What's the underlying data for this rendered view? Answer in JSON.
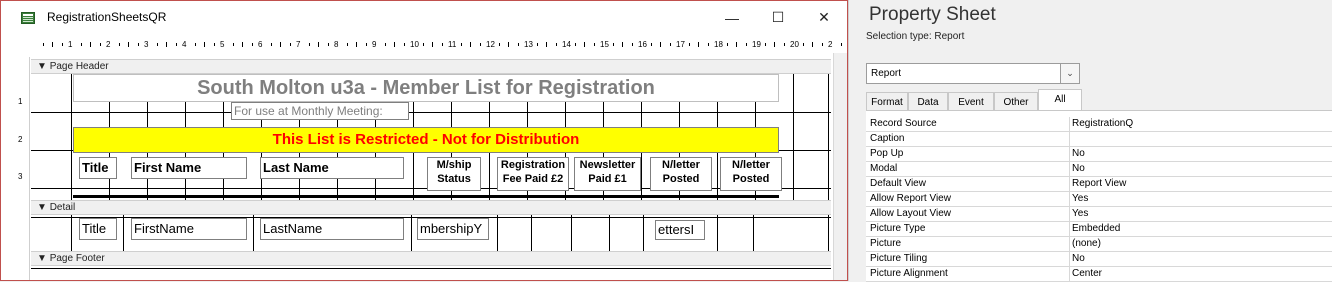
{
  "report_window": {
    "title": "RegistrationSheetsQR",
    "controls": {
      "minimize": "—",
      "maximize": "☐",
      "close": "✕"
    },
    "ruler_numbers": [
      "1",
      "2",
      "3",
      "4",
      "5",
      "6",
      "7",
      "8",
      "9",
      "10",
      "11",
      "12",
      "13",
      "14",
      "15",
      "16",
      "17",
      "18",
      "19",
      "20",
      "2"
    ],
    "left_ruler_numbers": [
      "1",
      "2",
      "3"
    ],
    "sections": {
      "page_header": "Page Header",
      "detail": "Detail",
      "page_footer": "Page Footer"
    },
    "header": {
      "title": "South Molton u3a - Member List for Registration",
      "subtitle": "For use at Monthly Meeting:",
      "banner": "This List is Restricted - Not for Distribution",
      "banner_color": "#ffff00",
      "banner_text_color": "#ff0000",
      "columns": {
        "title": "Title",
        "first_name": "First Name",
        "last_name": "Last Name",
        "mship_status": "M/ship\nStatus",
        "reg_fee": "Registration\nFee Paid £2",
        "newsletter_paid": "Newsletter\nPaid £1",
        "nletter_posted_1": "N/letter\nPosted",
        "nletter_posted_2": "N/letter\nPosted"
      }
    },
    "detail": {
      "title": "Title",
      "first_name": "FirstName",
      "last_name": "LastName",
      "membership": "mbershipY",
      "letters": "ettersI"
    }
  },
  "property_sheet": {
    "title": "Property Sheet",
    "selection_type": "Selection type:  Report",
    "selected_object": "Report",
    "tabs": [
      "Format",
      "Data",
      "Event",
      "Other",
      "All"
    ],
    "active_tab": "All",
    "properties": [
      {
        "name": "Record Source",
        "value": "RegistrationQ"
      },
      {
        "name": "Caption",
        "value": ""
      },
      {
        "name": "Pop Up",
        "value": "No"
      },
      {
        "name": "Modal",
        "value": "No"
      },
      {
        "name": "Default View",
        "value": "Report View"
      },
      {
        "name": "Allow Report View",
        "value": "Yes"
      },
      {
        "name": "Allow Layout View",
        "value": "Yes"
      },
      {
        "name": "Picture Type",
        "value": "Embedded"
      },
      {
        "name": "Picture",
        "value": "(none)"
      },
      {
        "name": "Picture Tiling",
        "value": "No"
      },
      {
        "name": "Picture Alignment",
        "value": "Center"
      }
    ]
  }
}
